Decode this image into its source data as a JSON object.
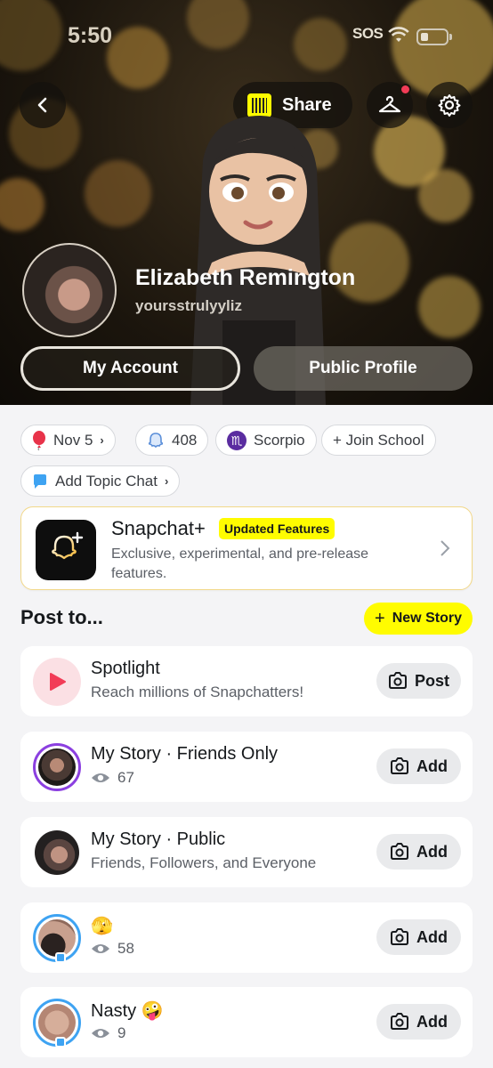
{
  "status_bar": {
    "time": "5:50",
    "sos": "SOS"
  },
  "header": {
    "share_label": "Share",
    "profile_name": "Elizabeth Remington",
    "username": "yoursstrulyyliz",
    "my_account_label": "My Account",
    "public_profile_label": "Public Profile"
  },
  "chips": {
    "birthday": "Nov 5",
    "snapscore": "408",
    "zodiac": "Scorpio",
    "join_school": "+ Join School",
    "topic_chat": "Add Topic Chat"
  },
  "snapchat_plus": {
    "title": "Snapchat+",
    "badge": "Updated Features",
    "subtitle": "Exclusive, experimental, and pre-release features."
  },
  "post_to": {
    "heading": "Post to...",
    "new_story_label": "New Story",
    "rows": [
      {
        "title": "Spotlight",
        "subtitle": "Reach millions of Snapchatters!",
        "button": "Post"
      },
      {
        "title": "My Story · Friends Only",
        "subtitle": "67",
        "button": "Add"
      },
      {
        "title": "My Story · Public",
        "subtitle": "Friends, Followers, and Everyone",
        "button": "Add"
      },
      {
        "title": "🫣",
        "subtitle": "58",
        "button": "Add"
      },
      {
        "title": "Nasty 🤪",
        "subtitle": "9",
        "button": "Add"
      }
    ]
  },
  "colors": {
    "snap_yellow": "#fffc00",
    "story_ring_purple": "#8b3fe0",
    "private_ring_blue": "#3ea3f2",
    "spotlight_red": "#f23c57"
  }
}
